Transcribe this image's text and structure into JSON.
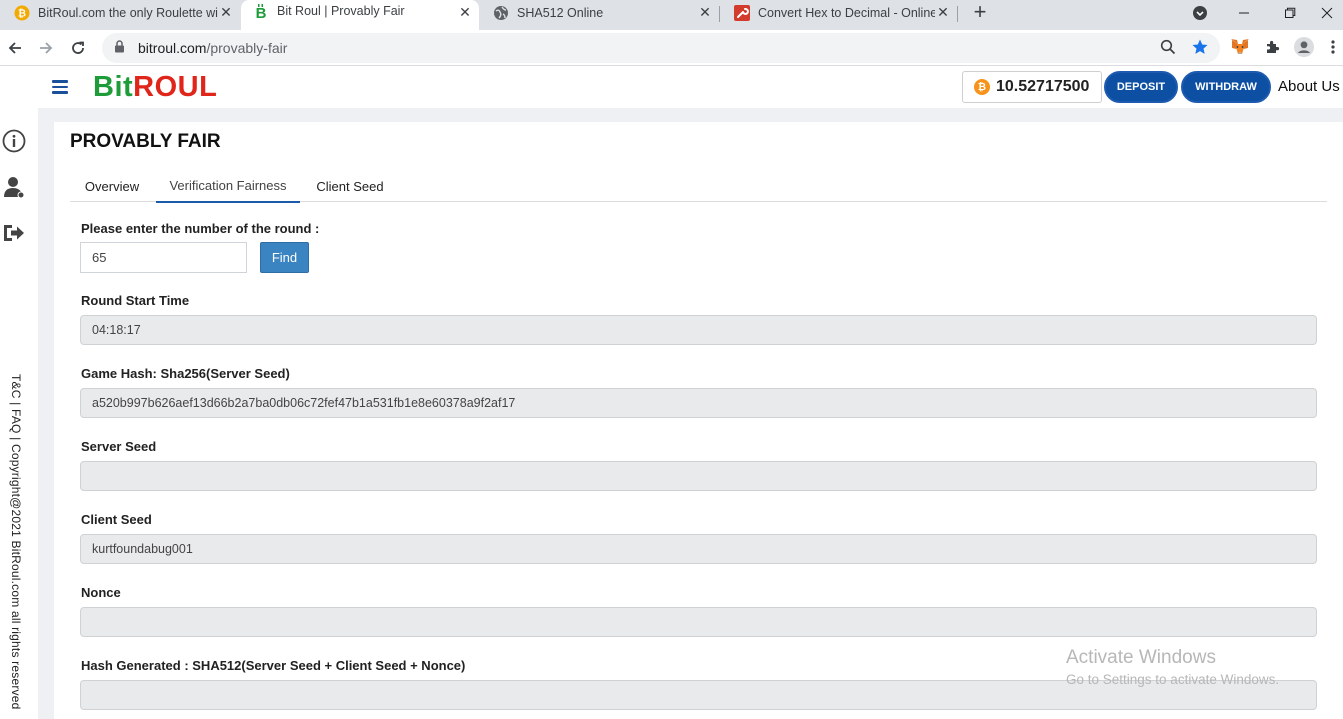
{
  "browser": {
    "tabs": [
      {
        "title": "BitRoul.com the only Roulette wi",
        "icon": "bitcoin-icon"
      },
      {
        "title": "Bit Roul | Provably Fair",
        "icon": "bitroul-favicon"
      },
      {
        "title": "SHA512 Online",
        "icon": "globe-icon"
      },
      {
        "title": "Convert Hex to Decimal - Online",
        "icon": "wrench-icon"
      }
    ],
    "new_tab": "+",
    "url_host": "bitroul.com",
    "url_path": "/provably-fair"
  },
  "header": {
    "logo_bit": "Bit",
    "logo_roul": "ROUL",
    "balance": "10.52717500",
    "coin_symbol": "₿",
    "deposit_label": "DEPOSIT",
    "withdraw_label": "WITHDRAW",
    "about_label": "About Us"
  },
  "sidebar": {
    "footer_text": "T&C | FAQ | Copyright@2021 BitRoul.com all rights reserved"
  },
  "page": {
    "title": "PROVABLY FAIR",
    "tabs": [
      {
        "label": "Overview"
      },
      {
        "label": "Verification Fairness",
        "active": true
      },
      {
        "label": "Client Seed"
      }
    ],
    "round_prompt": "Please enter the number of the round :",
    "round_value": "65",
    "find_label": "Find",
    "fields": [
      {
        "label": "Round Start Time",
        "value": "04:18:17"
      },
      {
        "label": "Game Hash: Sha256(Server Seed)",
        "value": "a520b997b626aef13d66b2a7ba0db06c72fef47b1a531fb1e8e60378a9f2af17"
      },
      {
        "label": "Server Seed",
        "value": ""
      },
      {
        "label": "Client Seed",
        "value": "kurtfoundabug001"
      },
      {
        "label": "Nonce",
        "value": ""
      },
      {
        "label": "Hash Generated : SHA512(Server Seed + Client Seed + Nonce)",
        "value": ""
      }
    ]
  },
  "watermark": {
    "line1": "Activate Windows",
    "line2": "Go to Settings to activate Windows."
  },
  "colors": {
    "brand_green": "#1e9c3a",
    "brand_red": "#e0261b",
    "button_blue": "#0c4fa3",
    "find_blue": "#3b84c2"
  }
}
